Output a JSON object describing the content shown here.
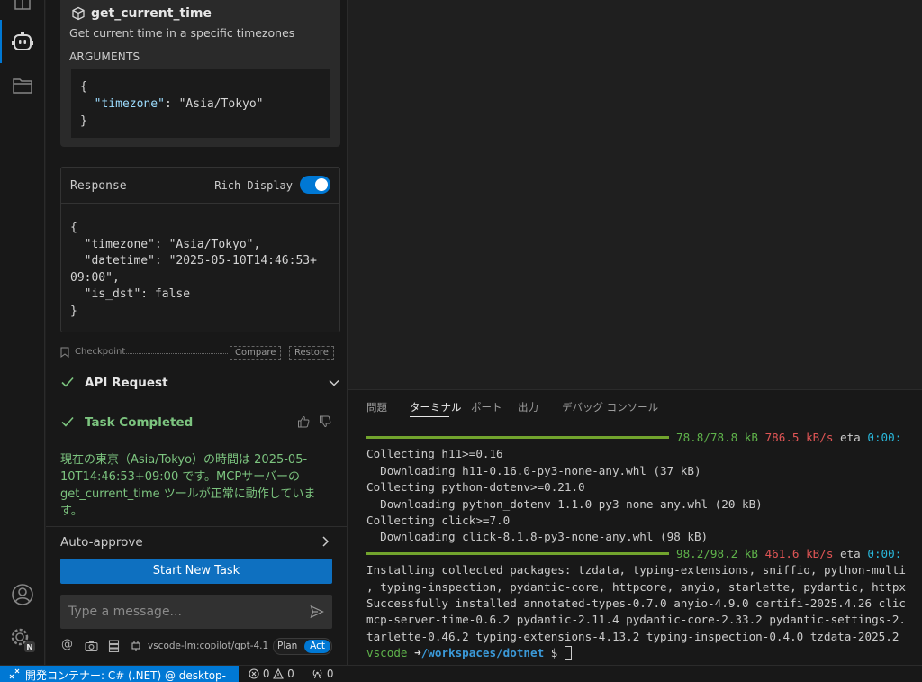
{
  "tool": {
    "name": "get_current_time",
    "description": "Get current time in a specific timezones",
    "arguments_label": "ARGUMENTS",
    "arguments": {
      "open": "{",
      "key": "\"timezone\"",
      "sep": ": ",
      "value": "\"Asia/Tokyo\"",
      "close": "}"
    }
  },
  "response": {
    "title": "Response",
    "rich_display_label": "Rich Display",
    "rich_display_on": true,
    "body": "{\n  \"timezone\": \"Asia/Tokyo\",\n  \"datetime\": \"2025-05-10T14:46:53+\n09:00\",\n  \"is_dst\": false\n}"
  },
  "checkpoint": {
    "label": "Checkpoint",
    "compare": "Compare",
    "restore": "Restore"
  },
  "api_request": {
    "label": "API Request"
  },
  "task": {
    "label": "Task Completed",
    "result": "現在の東京（Asia/Tokyo）の時間は 2025-05-10T14:46:53+09:00 です。MCPサーバーの get_current_time ツールが正常に動作しています。"
  },
  "auto_approve": {
    "label": "Auto-approve"
  },
  "start_button": {
    "label": "Start New Task"
  },
  "message_input": {
    "placeholder": "Type a message..."
  },
  "bottom_tools": {
    "model": "vscode-lm:copilot/gpt-4.1",
    "plan": "Plan",
    "act": "Act"
  },
  "terminal": {
    "tabs": [
      "問題",
      "ターミナル",
      "ポート",
      "出力",
      "デバッグ コンソール"
    ],
    "active_tab": "ターミナル",
    "lines": [
      {
        "type": "progress",
        "size": "78.8/78.8 kB",
        "speed": "786.5 kB/s",
        "eta_label": "eta",
        "eta": "0:00:"
      },
      {
        "type": "text",
        "text": "Collecting h11>=0.16"
      },
      {
        "type": "text",
        "text": "  Downloading h11-0.16.0-py3-none-any.whl (37 kB)"
      },
      {
        "type": "text",
        "text": "Collecting python-dotenv>=0.21.0"
      },
      {
        "type": "text",
        "text": "  Downloading python_dotenv-1.1.0-py3-none-any.whl (20 kB)"
      },
      {
        "type": "text",
        "text": "Collecting click>=7.0"
      },
      {
        "type": "text",
        "text": "  Downloading click-8.1.8-py3-none-any.whl (98 kB)"
      },
      {
        "type": "progress",
        "size": "98.2/98.2 kB",
        "speed": "461.6 kB/s",
        "eta_label": "eta",
        "eta": "0:00:"
      },
      {
        "type": "text",
        "text": "Installing collected packages: tzdata, typing-extensions, sniffio, python-multi"
      },
      {
        "type": "text",
        "text": ", typing-inspection, pydantic-core, httpcore, anyio, starlette, pydantic, httpx"
      },
      {
        "type": "text",
        "text": "Successfully installed annotated-types-0.7.0 anyio-4.9.0 certifi-2025.4.26 clic"
      },
      {
        "type": "text",
        "text": "mcp-server-time-0.6.2 pydantic-2.11.4 pydantic-core-2.33.2 pydantic-settings-2."
      },
      {
        "type": "text",
        "text": "tarlette-0.46.2 typing-extensions-4.13.2 typing-inspection-0.4.0 tzdata-2025.2"
      },
      {
        "type": "prompt",
        "user": "vscode",
        "arrow": "➜",
        "path": "/workspaces/dotnet",
        "symbol": "$"
      }
    ]
  },
  "statusbar": {
    "remote": "開発コンテナー: C# (.NET) @ desktop-linux",
    "errors": "0",
    "warnings": "0",
    "ports": "0"
  },
  "colors": {
    "accent": "#0078d4",
    "success": "#7cc47f",
    "progress_bar": "#72a42d"
  }
}
